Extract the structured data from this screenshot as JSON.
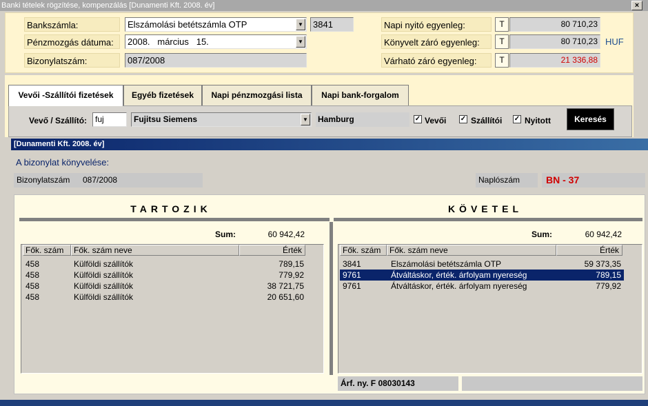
{
  "window": {
    "title": "Banki tételek rögzítése, kompenzálás  [Dunamenti Kft.  2008. év]",
    "close": "×"
  },
  "header": {
    "bankszamla_label": "Bankszámla:",
    "bankszamla_value": "Elszámolási betétszámla OTP",
    "bankszamla_code": "3841",
    "datum_label": "Pénzmozgás dátuma:",
    "datum_value": "2008.   március   15.",
    "bizonylat_label": "Bizonylatszám:",
    "bizonylat_value": "087/2008",
    "napi_nyito_label": "Napi nyitó egyenleg:",
    "napi_nyito_t": "T",
    "napi_nyito_value": "80 710,23",
    "konyvelt_label": "Könyvelt záró egyenleg:",
    "konyvelt_t": "T",
    "konyvelt_value": "80 710,23",
    "currency": "HUF",
    "varhato_label": "Várható záró egyenleg:",
    "varhato_t": "T",
    "varhato_value": "21 336,88"
  },
  "tabs": [
    {
      "label": "Vevői -Szállítói fizetések"
    },
    {
      "label": "Egyéb fizetések"
    },
    {
      "label": "Napi pénzmozgási lista"
    },
    {
      "label": "Napi bank-forgalom"
    }
  ],
  "filter": {
    "partner_label": "Vevő / Szállító:",
    "partner_code": "fuj",
    "partner_name": "Fujitsu Siemens",
    "city": "Hamburg",
    "vevoi_label": "Vevői",
    "szallitoi_label": "Szállítói",
    "nyitott_label": "Nyitott",
    "check_mark": "✓",
    "search_label": "Keresés"
  },
  "inner": {
    "title": "[Dunamenti Kft.  2008. év]",
    "heading": "A bizonylat könyvelése:",
    "bizonylat_label": "Bizonylatszám",
    "bizonylat_value": "087/2008",
    "naplo_label": "Naplószám",
    "naplo_value": "BN - 37"
  },
  "tartozik": {
    "title": "TARTOZIK",
    "sum_label": "Sum:",
    "sum_value": "60 942,42",
    "columns": [
      "Fők. szám",
      "Fők. szám neve",
      "Érték"
    ],
    "rows": [
      {
        "code": "458",
        "name": "Külföldi szállítók",
        "value": "789,15"
      },
      {
        "code": "458",
        "name": "Külföldi szállítók",
        "value": "779,92"
      },
      {
        "code": "458",
        "name": "Külföldi szállítók",
        "value": "38 721,75"
      },
      {
        "code": "458",
        "name": "Külföldi szállítók",
        "value": "20 651,60"
      }
    ]
  },
  "kovetel": {
    "title": "KÖVETEL",
    "sum_label": "Sum:",
    "sum_value": "60 942,42",
    "columns": [
      "Fők. szám",
      "Fők. szám neve",
      "Érték"
    ],
    "rows": [
      {
        "code": "3841",
        "name": "Elszámolási betétszámla OTP",
        "value": "59 373,35",
        "selected": false
      },
      {
        "code": "9761",
        "name": "Átváltáskor, érték. árfolyam nyereség",
        "value": "789,15",
        "selected": true
      },
      {
        "code": "9761",
        "name": "Átváltáskor, érték. árfolyam nyereség",
        "value": "779,92",
        "selected": false
      }
    ]
  },
  "footer": {
    "arf_label": "Árf. ny. F 08030143"
  },
  "colors": {
    "accent": "#0a246a",
    "negative": "#d00000",
    "cream": "#fff5d0"
  }
}
